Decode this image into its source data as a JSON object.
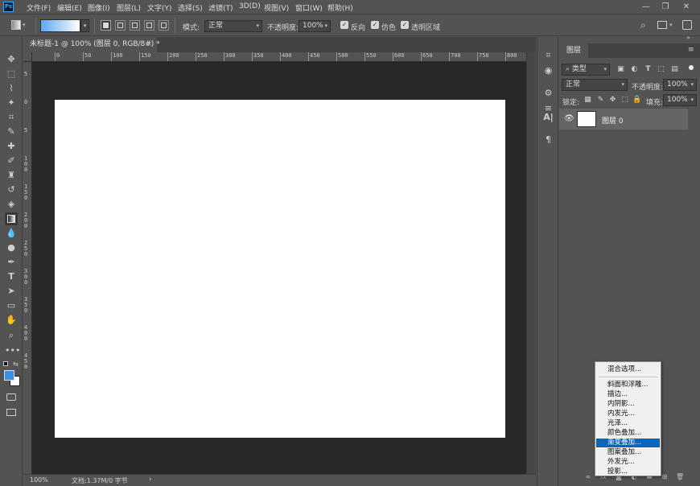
{
  "menubar": {
    "logo": "Ps",
    "items": [
      "文件(F)",
      "编辑(E)",
      "图像(I)",
      "图层(L)",
      "文字(Y)",
      "选择(S)",
      "滤镜(T)",
      "3D(D)",
      "视图(V)",
      "窗口(W)",
      "帮助(H)"
    ],
    "controls": {
      "minimize": "—",
      "restore": "❐",
      "close": "✕"
    }
  },
  "options": {
    "mode_label": "模式:",
    "mode_value": "正常",
    "opacity_label": "不透明度:",
    "opacity_value": "100%",
    "reverse_label": "反向",
    "dither_label": "仿色",
    "transparency_label": "透明区域",
    "gradient_colors": [
      "#5ea8f5",
      "#ffffff"
    ]
  },
  "document": {
    "tab_title": "未标题-1 @ 100% (图层 0, RGB/8#) *",
    "close": "×",
    "ruler_h_labels": [
      "0",
      "50",
      "100",
      "150",
      "200",
      "250",
      "300",
      "350",
      "400",
      "450",
      "500",
      "550",
      "600",
      "650",
      "700",
      "750",
      "800"
    ],
    "ruler_v_labels": [
      "5",
      "0",
      "5",
      "1 0 0",
      "1 5 0",
      "2 0 0",
      "2 5 0",
      "3 0 0",
      "3 5 0",
      "4 0 0",
      "4 5 0"
    ]
  },
  "status": {
    "zoom": "100%",
    "doc_info": "文档:1.37M/0 字节",
    "arrow": "›"
  },
  "colors": {
    "foreground": "#3c8ee8",
    "background": "#ffffff",
    "ui_bg": "#535353",
    "canvas_bg": "#282828",
    "highlight": "#0a64b8"
  },
  "layers_panel": {
    "tab": "图层",
    "filter_label": "类型",
    "blend_mode": "正常",
    "opacity_label": "不透明度:",
    "opacity_value": "100%",
    "lock_label": "锁定:",
    "fill_label": "填充:",
    "fill_value": "100%",
    "layer_name": "图层 0"
  },
  "fx_menu": {
    "items": [
      "混合选项...",
      "斜面和浮雕...",
      "描边...",
      "内阴影...",
      "内发光...",
      "光泽...",
      "颜色叠加...",
      "渐变叠加...",
      "图案叠加...",
      "外发光...",
      "投影..."
    ],
    "highlighted": "渐变叠加..."
  }
}
